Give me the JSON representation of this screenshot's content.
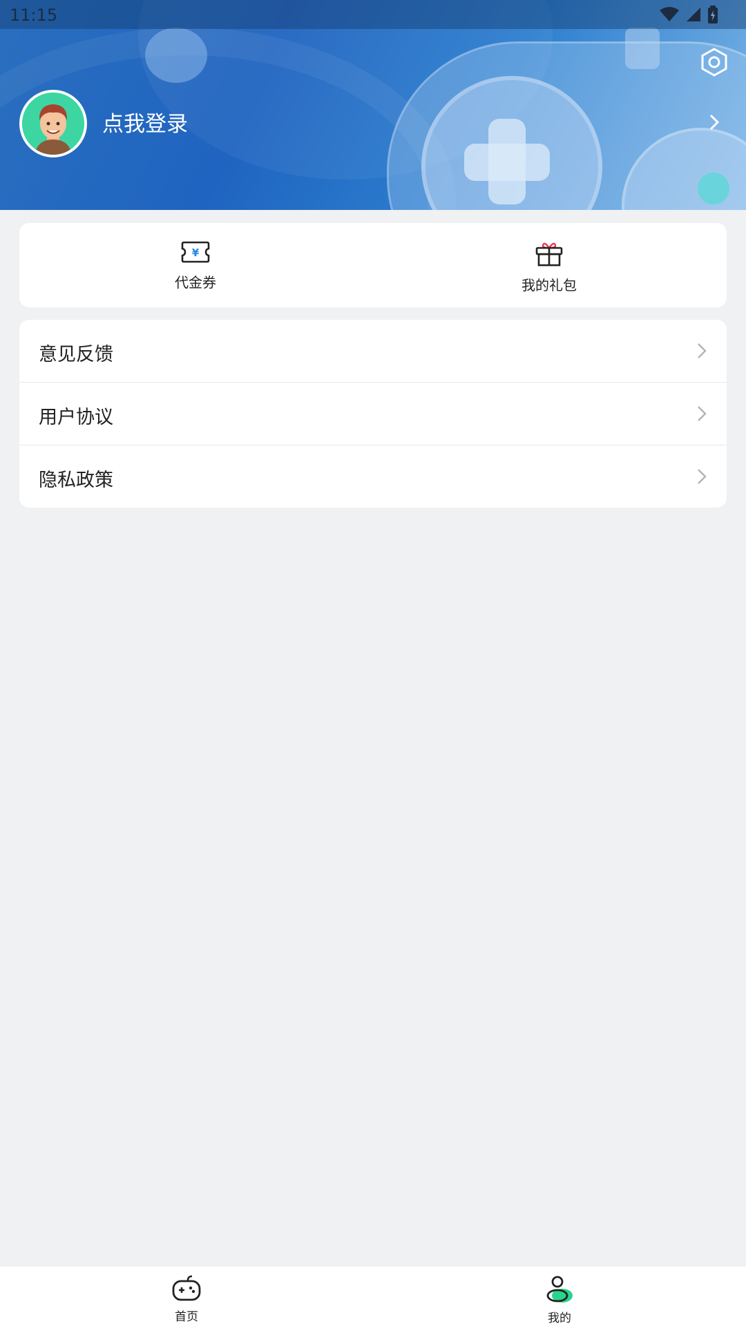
{
  "status_bar": {
    "time": "11:15"
  },
  "header": {
    "login_text": "点我登录"
  },
  "quick": [
    {
      "label": "代金券",
      "icon": "voucher-icon"
    },
    {
      "label": "我的礼包",
      "icon": "gift-icon"
    }
  ],
  "menu": [
    {
      "label": "意见反馈"
    },
    {
      "label": "用户协议"
    },
    {
      "label": "隐私政策"
    }
  ],
  "nav": [
    {
      "label": "首页",
      "icon": "gamepad-icon"
    },
    {
      "label": "我的",
      "icon": "profile-icon",
      "active": true
    }
  ],
  "colors": {
    "accent": "#1f64c0",
    "active_green": "#2ad48e",
    "voucher_blue": "#1e88e5",
    "gift_red": "#e53950"
  }
}
